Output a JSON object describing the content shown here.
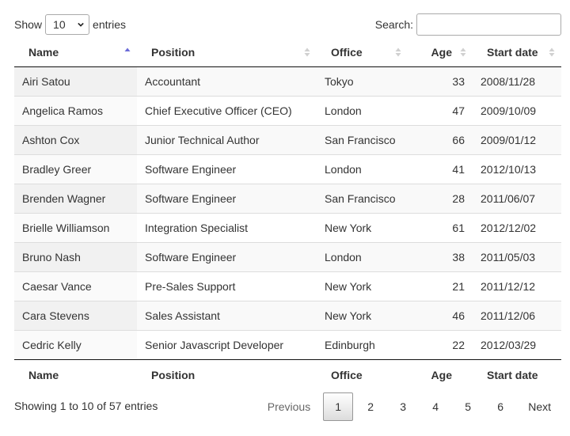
{
  "length_control": {
    "prefix": "Show",
    "selected": "10",
    "suffix": "entries"
  },
  "search": {
    "label": "Search:",
    "value": "",
    "placeholder": ""
  },
  "table": {
    "columns": [
      {
        "label": "Name",
        "sort": "ascending"
      },
      {
        "label": "Position",
        "sort": "none"
      },
      {
        "label": "Office",
        "sort": "none"
      },
      {
        "label": "Age",
        "sort": "none"
      },
      {
        "label": "Start date",
        "sort": "none"
      }
    ],
    "rows": [
      {
        "name": "Airi Satou",
        "position": "Accountant",
        "office": "Tokyo",
        "age": "33",
        "start_date": "2008/11/28"
      },
      {
        "name": "Angelica Ramos",
        "position": "Chief Executive Officer (CEO)",
        "office": "London",
        "age": "47",
        "start_date": "2009/10/09"
      },
      {
        "name": "Ashton Cox",
        "position": "Junior Technical Author",
        "office": "San Francisco",
        "age": "66",
        "start_date": "2009/01/12"
      },
      {
        "name": "Bradley Greer",
        "position": "Software Engineer",
        "office": "London",
        "age": "41",
        "start_date": "2012/10/13"
      },
      {
        "name": "Brenden Wagner",
        "position": "Software Engineer",
        "office": "San Francisco",
        "age": "28",
        "start_date": "2011/06/07"
      },
      {
        "name": "Brielle Williamson",
        "position": "Integration Specialist",
        "office": "New York",
        "age": "61",
        "start_date": "2012/12/02"
      },
      {
        "name": "Bruno Nash",
        "position": "Software Engineer",
        "office": "London",
        "age": "38",
        "start_date": "2011/05/03"
      },
      {
        "name": "Caesar Vance",
        "position": "Pre-Sales Support",
        "office": "New York",
        "age": "21",
        "start_date": "2011/12/12"
      },
      {
        "name": "Cara Stevens",
        "position": "Sales Assistant",
        "office": "New York",
        "age": "46",
        "start_date": "2011/12/06"
      },
      {
        "name": "Cedric Kelly",
        "position": "Senior Javascript Developer",
        "office": "Edinburgh",
        "age": "22",
        "start_date": "2012/03/29"
      }
    ]
  },
  "info": "Showing 1 to 10 of 57 entries",
  "pagination": {
    "previous": "Previous",
    "pages": [
      "1",
      "2",
      "3",
      "4",
      "5",
      "6"
    ],
    "current": "1",
    "next": "Next"
  },
  "colors": {
    "sort_active": "#6b6bd8",
    "sort_inactive": "#d0d0d0"
  }
}
